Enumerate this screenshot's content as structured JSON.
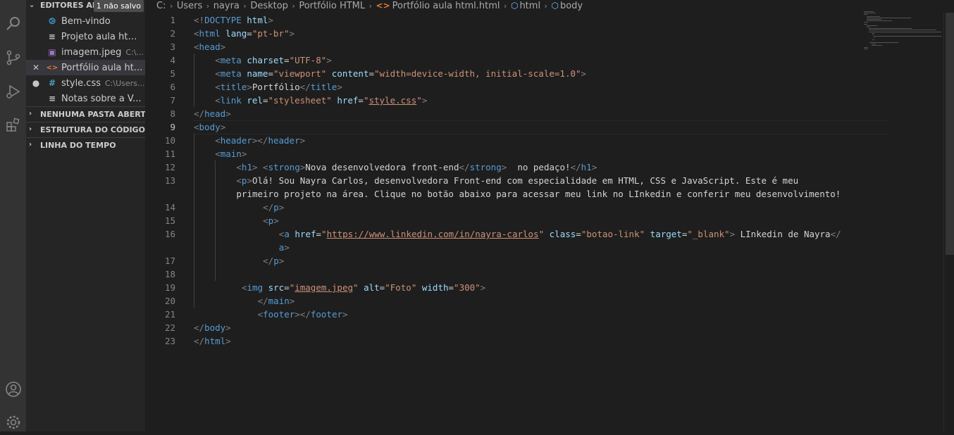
{
  "sidebar": {
    "open_editors": {
      "title": "EDITORES AB...",
      "badge": "1 não salvo",
      "files": [
        {
          "name": "Bem-vindo",
          "path": "",
          "icon": "vscode-icon",
          "icon_color": "#3c99d4",
          "active": false,
          "lead": ""
        },
        {
          "name": "Projeto aula htm...",
          "path": "",
          "icon": "lines-icon",
          "icon_color": "#c5c5c5",
          "active": false,
          "lead": ""
        },
        {
          "name": "imagem.jpeg",
          "path": "C:\\...",
          "icon": "image-icon",
          "icon_color": "#a074c4",
          "active": false,
          "lead": ""
        },
        {
          "name": "Portfólio aula ht...",
          "path": "",
          "icon": "html-icon",
          "icon_color": "#e37933",
          "active": true,
          "lead": "✕"
        },
        {
          "name": "style.css",
          "path": "C:\\Users...",
          "icon": "css-icon",
          "icon_color": "#519aba",
          "active": false,
          "lead": "●"
        },
        {
          "name": "Notas sobre a V...",
          "path": "",
          "icon": "lines-icon",
          "icon_color": "#c5c5c5",
          "active": false,
          "lead": ""
        }
      ]
    },
    "sections": [
      "NENHUMA PASTA ABERTA",
      "ESTRUTURA DO CÓDIGO",
      "LINHA DO TEMPO"
    ]
  },
  "breadcrumb": {
    "parts": [
      "C:",
      "Users",
      "nayra",
      "Desktop",
      "Portfólio HTML"
    ],
    "file": "Portfólio aula html.html",
    "symbols": [
      "html",
      "body"
    ]
  },
  "editor": {
    "current_line": "9",
    "lines": [
      {
        "n": "1",
        "indent": 0,
        "tokens": [
          [
            "p",
            "<!"
          ],
          [
            "t",
            "DOCTYPE"
          ],
          [
            "x",
            " "
          ],
          [
            "a",
            "html"
          ],
          [
            "p",
            ">"
          ]
        ]
      },
      {
        "n": "2",
        "indent": 0,
        "tokens": [
          [
            "p",
            "<"
          ],
          [
            "t",
            "html"
          ],
          [
            "x",
            " "
          ],
          [
            "a",
            "lang"
          ],
          [
            "x",
            "="
          ],
          [
            "s",
            "\"pt-br\""
          ],
          [
            "p",
            ">"
          ]
        ]
      },
      {
        "n": "3",
        "indent": 0,
        "tokens": [
          [
            "p",
            "<"
          ],
          [
            "t",
            "head"
          ],
          [
            "p",
            ">"
          ]
        ]
      },
      {
        "n": "4",
        "indent": 4,
        "tokens": [
          [
            "p",
            "<"
          ],
          [
            "t",
            "meta"
          ],
          [
            "x",
            " "
          ],
          [
            "a",
            "charset"
          ],
          [
            "x",
            "="
          ],
          [
            "s",
            "\"UTF-8\""
          ],
          [
            "p",
            ">"
          ]
        ]
      },
      {
        "n": "5",
        "indent": 4,
        "tokens": [
          [
            "p",
            "<"
          ],
          [
            "t",
            "meta"
          ],
          [
            "x",
            " "
          ],
          [
            "a",
            "name"
          ],
          [
            "x",
            "="
          ],
          [
            "s",
            "\"viewport\""
          ],
          [
            "x",
            " "
          ],
          [
            "a",
            "content"
          ],
          [
            "x",
            "="
          ],
          [
            "s",
            "\"width=device-width, initial-scale=1.0\""
          ],
          [
            "p",
            ">"
          ]
        ]
      },
      {
        "n": "6",
        "indent": 4,
        "tokens": [
          [
            "p",
            "<"
          ],
          [
            "t",
            "title"
          ],
          [
            "p",
            ">"
          ],
          [
            "x",
            "Portfólio"
          ],
          [
            "p",
            "</"
          ],
          [
            "t",
            "title"
          ],
          [
            "p",
            ">"
          ]
        ]
      },
      {
        "n": "7",
        "indent": 4,
        "tokens": [
          [
            "p",
            "<"
          ],
          [
            "t",
            "link"
          ],
          [
            "x",
            " "
          ],
          [
            "a",
            "rel"
          ],
          [
            "x",
            "="
          ],
          [
            "s",
            "\"stylesheet\""
          ],
          [
            "x",
            " "
          ],
          [
            "a",
            "href"
          ],
          [
            "x",
            "="
          ],
          [
            "s",
            "\""
          ],
          [
            "su",
            "style.css"
          ],
          [
            "s",
            "\""
          ],
          [
            "p",
            ">"
          ]
        ]
      },
      {
        "n": "8",
        "indent": 0,
        "tokens": [
          [
            "p",
            "</"
          ],
          [
            "t",
            "head"
          ],
          [
            "p",
            ">"
          ]
        ]
      },
      {
        "n": "9",
        "indent": 0,
        "tokens": [
          [
            "p",
            "<"
          ],
          [
            "t",
            "body"
          ],
          [
            "p",
            ">"
          ]
        ]
      },
      {
        "n": "10",
        "indent": 4,
        "tokens": [
          [
            "p",
            "<"
          ],
          [
            "t",
            "header"
          ],
          [
            "p",
            "></"
          ],
          [
            "t",
            "header"
          ],
          [
            "p",
            ">"
          ]
        ]
      },
      {
        "n": "11",
        "indent": 4,
        "tokens": [
          [
            "p",
            "<"
          ],
          [
            "t",
            "main"
          ],
          [
            "p",
            ">"
          ]
        ]
      },
      {
        "n": "12",
        "indent": 8,
        "tokens": [
          [
            "p",
            "<"
          ],
          [
            "t",
            "h1"
          ],
          [
            "p",
            ">"
          ],
          [
            "x",
            " "
          ],
          [
            "p",
            "<"
          ],
          [
            "t",
            "strong"
          ],
          [
            "p",
            ">"
          ],
          [
            "x",
            "Nova desenvolvedora front-end"
          ],
          [
            "p",
            "</"
          ],
          [
            "t",
            "strong"
          ],
          [
            "p",
            ">"
          ],
          [
            "x",
            "  no pedaço!"
          ],
          [
            "p",
            "</"
          ],
          [
            "t",
            "h1"
          ],
          [
            "p",
            ">"
          ]
        ]
      },
      {
        "n": "13",
        "indent": 8,
        "tokens": [
          [
            "p",
            "<"
          ],
          [
            "t",
            "p"
          ],
          [
            "p",
            ">"
          ],
          [
            "x",
            "Olá! Sou Nayra Carlos, desenvolvedora Front-end com especialidade em HTML, CSS e JavaScript. Este é meu"
          ]
        ]
      },
      {
        "n": "",
        "indent": 8,
        "tokens": [
          [
            "x",
            "primeiro projeto na área. Clique no botão abaixo para acessar meu link no LInkedin e conferir meu desenvolvimento!"
          ]
        ]
      },
      {
        "n": "14",
        "indent": 13,
        "tokens": [
          [
            "p",
            "</"
          ],
          [
            "t",
            "p"
          ],
          [
            "p",
            ">"
          ]
        ]
      },
      {
        "n": "15",
        "indent": 13,
        "tokens": [
          [
            "p",
            "<"
          ],
          [
            "t",
            "p"
          ],
          [
            "p",
            ">"
          ]
        ]
      },
      {
        "n": "16",
        "indent": 16,
        "tokens": [
          [
            "p",
            "<"
          ],
          [
            "t",
            "a"
          ],
          [
            "x",
            " "
          ],
          [
            "a",
            "href"
          ],
          [
            "x",
            "="
          ],
          [
            "s",
            "\""
          ],
          [
            "su",
            "https://www.linkedin.com/in/nayra-carlos"
          ],
          [
            "s",
            "\""
          ],
          [
            "x",
            " "
          ],
          [
            "a",
            "class"
          ],
          [
            "x",
            "="
          ],
          [
            "s",
            "\"botao-link\""
          ],
          [
            "x",
            " "
          ],
          [
            "a",
            "target"
          ],
          [
            "x",
            "="
          ],
          [
            "s",
            "\"_blank\""
          ],
          [
            "p",
            ">"
          ],
          [
            "x",
            " LInkedin de Nayra"
          ],
          [
            "p",
            "</"
          ]
        ]
      },
      {
        "n": "",
        "indent": 16,
        "tokens": [
          [
            "t",
            "a"
          ],
          [
            "p",
            ">"
          ]
        ]
      },
      {
        "n": "17",
        "indent": 13,
        "tokens": [
          [
            "p",
            "</"
          ],
          [
            "t",
            "p"
          ],
          [
            "p",
            ">"
          ]
        ]
      },
      {
        "n": "18",
        "indent": 0,
        "tokens": []
      },
      {
        "n": "19",
        "indent": 9,
        "tokens": [
          [
            "p",
            "<"
          ],
          [
            "t",
            "img"
          ],
          [
            "x",
            " "
          ],
          [
            "a",
            "src"
          ],
          [
            "x",
            "="
          ],
          [
            "s",
            "\""
          ],
          [
            "su",
            "imagem.jpeg"
          ],
          [
            "s",
            "\""
          ],
          [
            "x",
            " "
          ],
          [
            "a",
            "alt"
          ],
          [
            "x",
            "="
          ],
          [
            "s",
            "\"Foto\""
          ],
          [
            "x",
            " "
          ],
          [
            "a",
            "width"
          ],
          [
            "x",
            "="
          ],
          [
            "s",
            "\"300\""
          ],
          [
            "p",
            ">"
          ]
        ]
      },
      {
        "n": "20",
        "indent": 12,
        "tokens": [
          [
            "p",
            "</"
          ],
          [
            "t",
            "main"
          ],
          [
            "p",
            ">"
          ]
        ]
      },
      {
        "n": "21",
        "indent": 12,
        "tokens": [
          [
            "p",
            "<"
          ],
          [
            "t",
            "footer"
          ],
          [
            "p",
            "></"
          ],
          [
            "t",
            "footer"
          ],
          [
            "p",
            ">"
          ]
        ]
      },
      {
        "n": "22",
        "indent": 0,
        "tokens": [
          [
            "p",
            "</"
          ],
          [
            "t",
            "body"
          ],
          [
            "p",
            ">"
          ]
        ]
      },
      {
        "n": "23",
        "indent": 0,
        "tokens": [
          [
            "p",
            "</"
          ],
          [
            "t",
            "html"
          ],
          [
            "p",
            ">"
          ]
        ]
      }
    ]
  }
}
